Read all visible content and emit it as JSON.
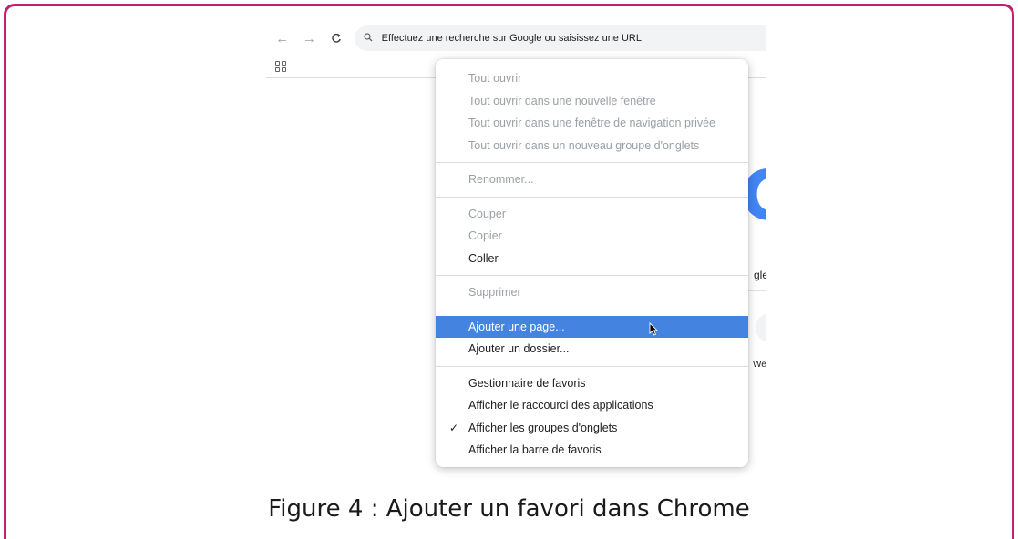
{
  "toolbar": {
    "back_icon": "←",
    "forward_icon": "→",
    "reload_icon": "C",
    "omnibox_icon": "🔍︎",
    "omnibox_placeholder": "Effectuez une recherche sur Google ou saisissez une URL"
  },
  "bookmarks_bar": {
    "apps_icon": "apps-grid-icon"
  },
  "page_behind": {
    "logo_letter": "G",
    "search_fragment": "gle",
    "shortcut_label": "We"
  },
  "context_menu": {
    "groups": [
      [
        {
          "label": "Tout ouvrir",
          "enabled": false
        },
        {
          "label": "Tout ouvrir dans une nouvelle fenêtre",
          "enabled": false
        },
        {
          "label": "Tout ouvrir dans une fenêtre de navigation privée",
          "enabled": false
        },
        {
          "label": "Tout ouvrir dans un nouveau groupe d'onglets",
          "enabled": false
        }
      ],
      [
        {
          "label": "Renommer...",
          "enabled": false
        }
      ],
      [
        {
          "label": "Couper",
          "enabled": false
        },
        {
          "label": "Copier",
          "enabled": false
        },
        {
          "label": "Coller",
          "enabled": true
        }
      ],
      [
        {
          "label": "Supprimer",
          "enabled": false
        }
      ],
      [
        {
          "label": "Ajouter une page...",
          "enabled": true,
          "selected": true
        },
        {
          "label": "Ajouter un dossier...",
          "enabled": true
        }
      ],
      [
        {
          "label": "Gestionnaire de favoris",
          "enabled": true
        },
        {
          "label": "Afficher le raccourci des applications",
          "enabled": true
        },
        {
          "label": "Afficher les groupes d'onglets",
          "enabled": true,
          "checked": true
        },
        {
          "label": "Afficher la barre de favoris",
          "enabled": true
        }
      ]
    ],
    "check_mark": "✓",
    "selected_color": "#4483e0"
  },
  "caption": "Figure 4 : Ajouter un favori dans Chrome",
  "colors": {
    "frame_border": "#c81e6e",
    "google_blue": "#4285f4"
  }
}
